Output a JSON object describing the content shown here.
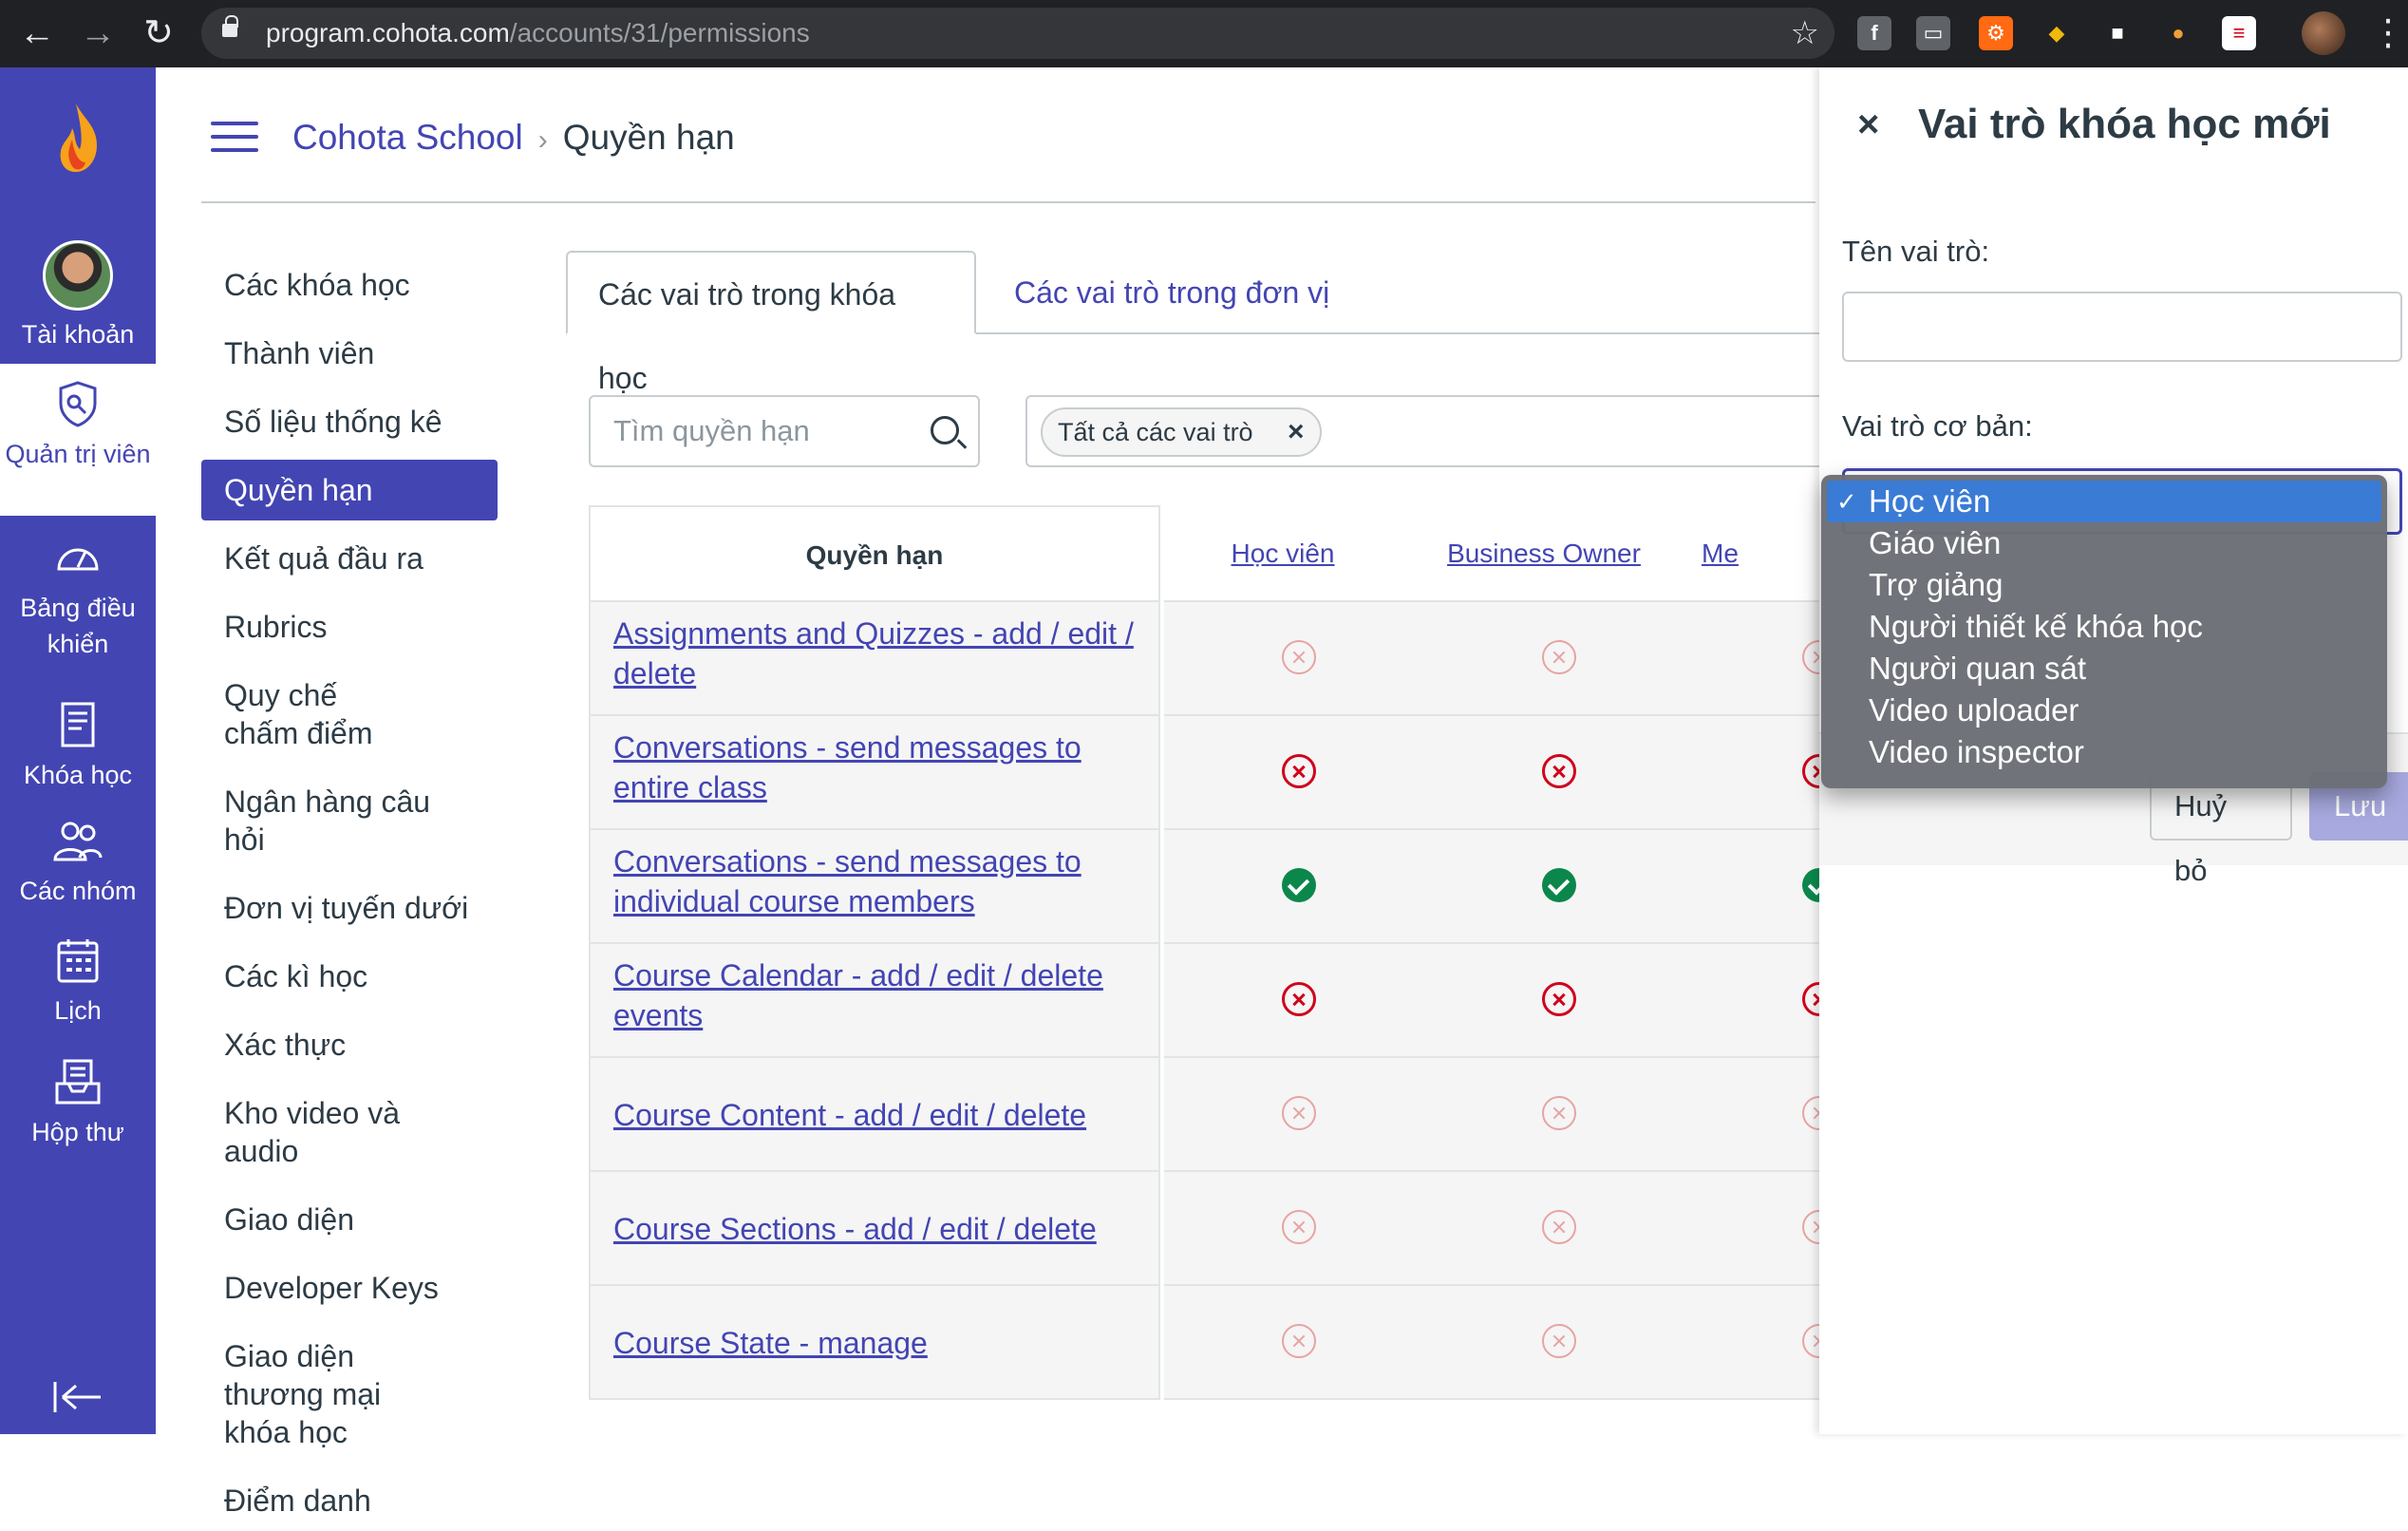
{
  "browser": {
    "url_host": "program.cohota.com",
    "url_path": "/accounts/31/permissions"
  },
  "global_nav": {
    "items": [
      {
        "label": "Tài khoản",
        "icon": "avatar"
      },
      {
        "label": "Quản trị viên",
        "icon": "shield-icon"
      },
      {
        "label": "Bảng điều khiển",
        "icon": "dashboard-icon"
      },
      {
        "label": "Khóa học",
        "icon": "book-icon"
      },
      {
        "label": "Các nhóm",
        "icon": "groups-icon"
      },
      {
        "label": "Lịch",
        "icon": "calendar-icon"
      },
      {
        "label": "Hộp thư",
        "icon": "inbox-icon"
      }
    ],
    "collapse_icon": "collapse-icon"
  },
  "header": {
    "breadcrumb_root": "Cohota School",
    "breadcrumb_current": "Quyền hạn"
  },
  "course_nav": {
    "items": [
      "Các khóa học",
      "Thành viên",
      "Số liệu thống kê",
      "Quyền hạn",
      "Kết quả đầu ra",
      "Rubrics",
      "Quy chế chấm điểm",
      "Ngân hàng câu hỏi",
      "Đơn vị tuyến dưới",
      "Các kì học",
      "Xác thực",
      "Kho video và audio",
      "Giao diện",
      "Developer Keys",
      "Giao diện thương mại khóa học",
      "Điểm danh"
    ],
    "active_index": 3
  },
  "tabs": {
    "course_roles": "Các vai trò trong khóa học",
    "unit_roles": "Các vai trò trong đơn vị"
  },
  "search": {
    "placeholder": "Tìm quyền hạn"
  },
  "filter": {
    "chip_label": "Tất cả các vai trò",
    "chip_remove": "×"
  },
  "table": {
    "columns": [
      "Quyền hạn",
      "Học viên",
      "Business Owner",
      "Me"
    ],
    "rows": [
      {
        "permission": "Assignments and Quizzes - add / edit / delete",
        "states": [
          "disabled",
          "disabled",
          "disabled"
        ]
      },
      {
        "permission": "Conversations - send messages to entire class",
        "states": [
          "denied",
          "denied",
          "denied"
        ]
      },
      {
        "permission": "Conversations - send messages to individual course members",
        "states": [
          "allowed",
          "allowed",
          "allowed"
        ]
      },
      {
        "permission": "Course Calendar - add / edit / delete events",
        "states": [
          "denied",
          "denied",
          "denied"
        ]
      },
      {
        "permission": "Course Content - add / edit / delete",
        "states": [
          "disabled",
          "disabled",
          "disabled"
        ]
      },
      {
        "permission": "Course Sections - add / edit / delete",
        "states": [
          "disabled",
          "disabled",
          "disabled"
        ]
      },
      {
        "permission": "Course State - manage",
        "states": [
          "disabled",
          "disabled",
          "disabled"
        ]
      }
    ]
  },
  "tray": {
    "close": "×",
    "title": "Vai trò khóa học mới",
    "role_name_label": "Tên vai trò:",
    "role_name_value": "",
    "base_role_label": "Vai trò cơ bản:",
    "base_role_options": [
      "Học viên",
      "Giáo viên",
      "Trợ giảng",
      "Người thiết kế khóa học",
      "Người quan sát",
      "Video uploader",
      "Video inspector"
    ],
    "selected_index": 0,
    "cancel": "Huỷ bỏ",
    "save": "Lưu"
  },
  "colors": {
    "brand": "#4345b3",
    "allowed": "#0b874b",
    "denied": "#d0021b"
  }
}
